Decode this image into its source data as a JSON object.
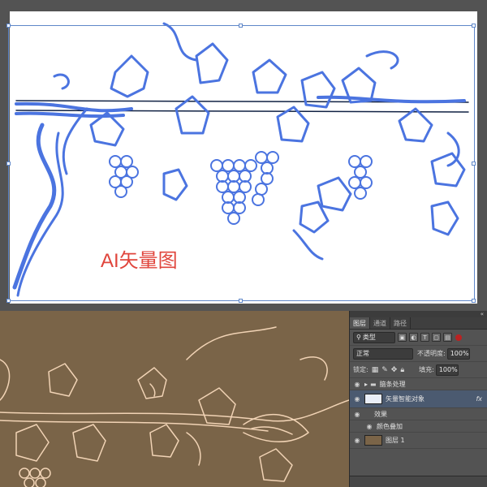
{
  "ai_canvas": {
    "overlay_label": "AI矢量图",
    "stroke_color": "#4b74e0"
  },
  "ps_canvas": {
    "background_color": "#7a6448",
    "line_color": "#f1d3b5"
  },
  "layers_panel": {
    "tabs": [
      "图层",
      "通道",
      "路径"
    ],
    "active_tab": 0,
    "filter": {
      "label": "类型"
    },
    "blend_mode": "正常",
    "opacity_label": "不透明度:",
    "opacity_value": "100%",
    "lock_label": "锁定:",
    "fill_label": "填充:",
    "fill_value": "100%",
    "layers": [
      {
        "name": "脑条处理",
        "type": "group",
        "visible": true
      },
      {
        "name": "矢量智能对象",
        "type": "smart-object",
        "visible": true,
        "selected": true,
        "fx_label": "fx"
      },
      {
        "name": "效果",
        "type": "effects-header",
        "visible": true
      },
      {
        "name": "颜色叠加",
        "type": "effect",
        "visible": true
      },
      {
        "name": "图层 1",
        "type": "raster",
        "visible": true
      }
    ]
  }
}
